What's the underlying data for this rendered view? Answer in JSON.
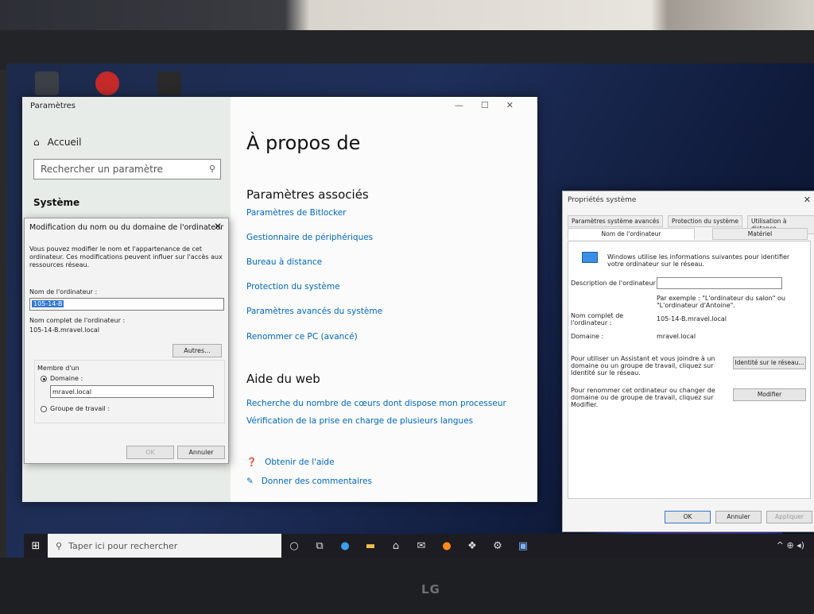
{
  "monitor": {
    "brand": "LG"
  },
  "settings": {
    "window_title": "Paramètres",
    "home_label": "Accueil",
    "search_placeholder": "Rechercher un paramètre",
    "section_label": "Système",
    "page_title": "À propos de",
    "related_heading": "Paramètres associés",
    "related_links": [
      "Paramètres de Bitlocker",
      "Gestionnaire de périphériques",
      "Bureau à distance",
      "Protection du système",
      "Paramètres avancés du système",
      "Renommer ce PC (avancé)"
    ],
    "web_heading": "Aide du web",
    "web_links": [
      "Recherche du nombre de cœurs dont dispose mon processeur",
      "Vérification de la prise en charge de plusieurs langues"
    ],
    "help_links": [
      "Obtenir de l'aide",
      "Donner des commentaires"
    ]
  },
  "rename_dialog": {
    "title": "Modification du nom ou du domaine de l'ordinateur",
    "description": "Vous pouvez modifier le nom et l'appartenance de cet ordinateur. Ces modifications peuvent influer sur l'accès aux ressources réseau.",
    "computer_name_label": "Nom de l'ordinateur :",
    "computer_name_value": "105-14-B",
    "full_name_label": "Nom complet de l'ordinateur :",
    "full_name_value": "105-14-B.mravel.local",
    "more_button": "Autres...",
    "member_of_label": "Membre d'un",
    "domain_label": "Domaine :",
    "domain_value": "mravel.local",
    "workgroup_label": "Groupe de travail :",
    "ok_button": "OK",
    "cancel_button": "Annuler"
  },
  "system_properties": {
    "title": "Propriétés système",
    "tabs_row1": [
      "Paramètres système avancés",
      "Protection du système",
      "Utilisation à distance"
    ],
    "tabs_row2": [
      "Nom de l'ordinateur",
      "Matériel"
    ],
    "info_text": "Windows utilise les informations suivantes pour identifier votre ordinateur sur le réseau.",
    "description_label": "Description de l'ordinateur :",
    "example_text": "Par exemple : \"L'ordinateur du salon\" ou \"L'ordinateur d'Antoine\".",
    "full_name_label": "Nom complet de l'ordinateur :",
    "full_name_value": "105-14-B.mravel.local",
    "domain_label": "Domaine :",
    "domain_value": "mravel.local",
    "wizard_text": "Pour utiliser un Assistant et vous joindre à un domaine ou un groupe de travail, cliquez sur Identité sur le réseau.",
    "network_id_button": "Identité sur le réseau...",
    "rename_text": "Pour renommer cet ordinateur ou changer de domaine ou de groupe de travail, cliquez sur Modifier.",
    "modify_button": "Modifier",
    "ok_button": "OK",
    "cancel_button": "Annuler",
    "apply_button": "Appliquer"
  },
  "taskbar": {
    "search_placeholder": "Taper ici pour rechercher"
  }
}
